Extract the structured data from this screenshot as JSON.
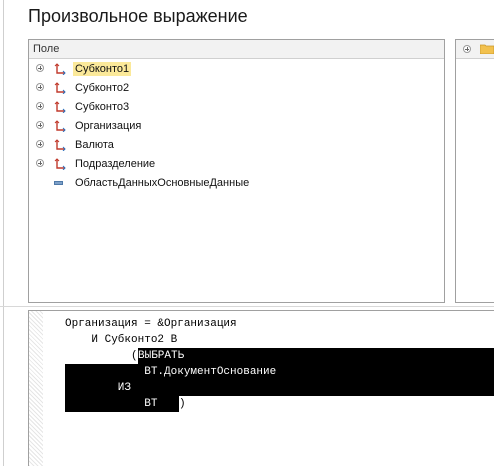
{
  "title": "Произвольное выражение",
  "tree": {
    "header": "Поле",
    "items": [
      {
        "label": "Субконто1",
        "selected": true,
        "icon": "dimension-icon"
      },
      {
        "label": "Субконто2",
        "icon": "dimension-icon"
      },
      {
        "label": "Субконто3",
        "icon": "dimension-icon"
      },
      {
        "label": "Организация",
        "icon": "dimension-icon"
      },
      {
        "label": "Валюта",
        "icon": "dimension-icon"
      },
      {
        "label": "Подразделение",
        "icon": "dimension-icon"
      },
      {
        "label": "ОбластьДанныхОсновныеДанные",
        "icon": "attribute-icon"
      }
    ]
  },
  "editor": {
    "line1": "Организация = &Организация",
    "line2": "    И Субконто2 В",
    "line3_paren": "(",
    "line3_sel": "ВЫБРАТЬ",
    "line4_sel": "            ВТ.ДокументОснование",
    "line5_sel": "        ИЗ",
    "line6_sel": "            ВТ",
    "line6_paren": ")"
  },
  "colors": {
    "selection_bg": "#fbe99a",
    "code_selection_bg": "#000000"
  }
}
